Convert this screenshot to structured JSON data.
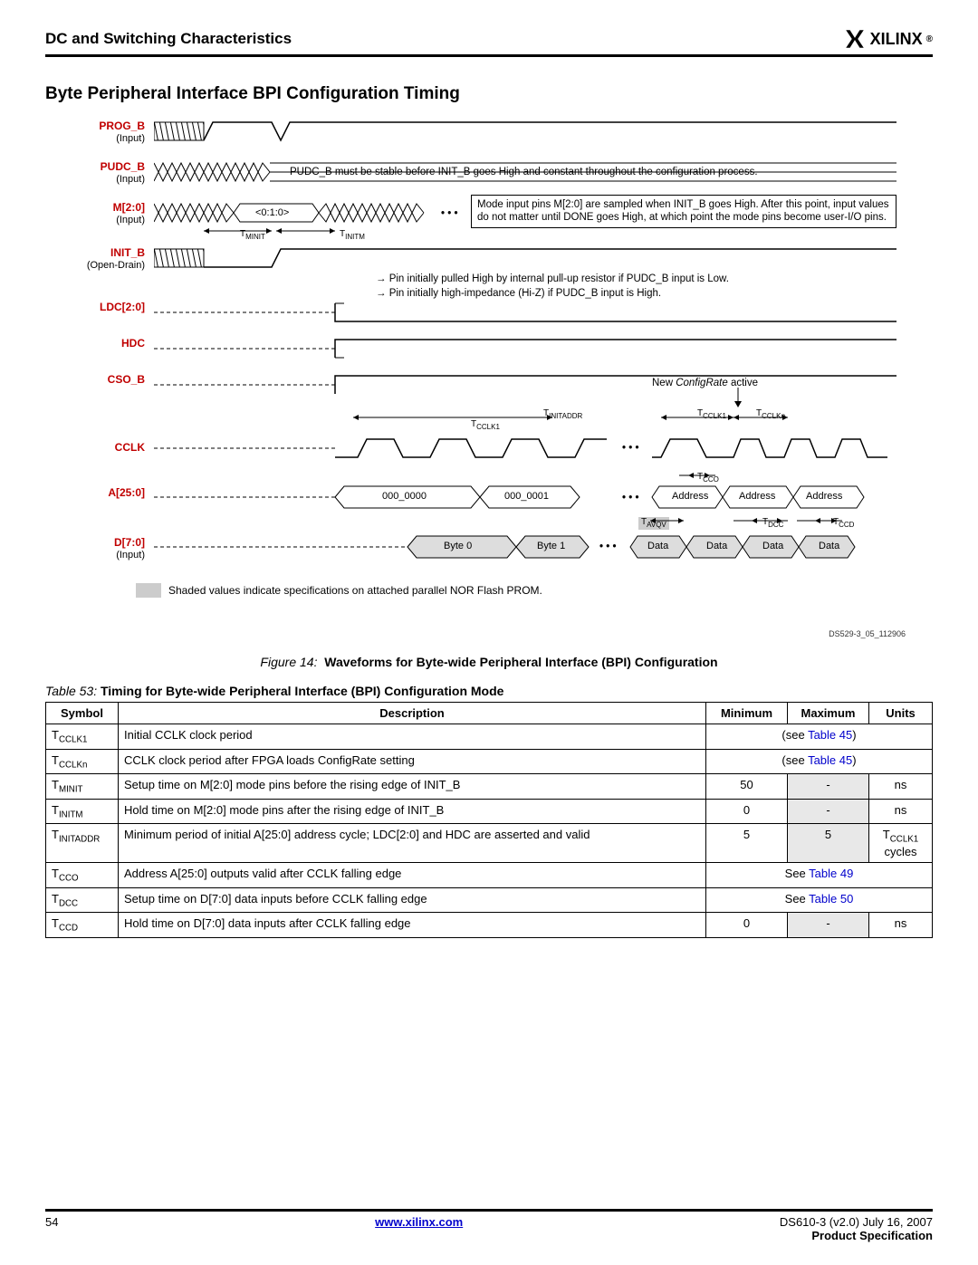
{
  "header": {
    "title": "DC and Switching Characteristics",
    "brand": "XILINX"
  },
  "section_title": "Byte Peripheral Interface BPI Configuration Timing",
  "diagram": {
    "signals": {
      "prog_b": {
        "name": "PROG_B",
        "sub": "(Input)"
      },
      "pudc_b": {
        "name": "PUDC_B",
        "sub": "(Input)"
      },
      "m20": {
        "name": "M[2:0]",
        "sub": "(Input)"
      },
      "init_b": {
        "name": "INIT_B",
        "sub": "(Open-Drain)"
      },
      "ldc": {
        "name": "LDC[2:0]"
      },
      "hdc": {
        "name": "HDC"
      },
      "cso_b": {
        "name": "CSO_B"
      },
      "cclk": {
        "name": "CCLK"
      },
      "a25": {
        "name": "A[25:0]"
      },
      "d7": {
        "name": "D[7:0]",
        "sub": "(Input)"
      }
    },
    "m_value": "<0:1:0>",
    "tlabels": {
      "tminit": "MINIT",
      "tinitm": "INITM",
      "tinitaddr": "INITADDR",
      "tcclk1": "CCLK1",
      "tcclkn": "CCLKn",
      "tcco": "CCO",
      "tavqv": "AVQV",
      "tdcc": "DCC",
      "tccd": "CCD"
    },
    "notes": {
      "pudc": "PUDC_B must be stable before INIT_B goes High and constant throughout the configuration process.",
      "mode": "Mode input pins M[2:0] are sampled when INIT_B goes High. After this point, input values do not matter until DONE goes High, at which point the mode pins become user-I/O pins.",
      "init_low": "Pin initially pulled High by internal pull-up resistor if PUDC_B input is Low.",
      "init_hiz": "Pin initially high-impedance (Hi-Z) if PUDC_B input is High.",
      "configrate": "New ConfigRate active"
    },
    "addr_values": {
      "a0": "000_0000",
      "a1": "000_0001",
      "an": "Address"
    },
    "data_values": {
      "d0": "Byte 0",
      "d1": "Byte 1",
      "dn": "Data"
    },
    "shaded_note": "Shaded values indicate specifications on attached parallel NOR Flash PROM.",
    "ds_id": "DS529-3_05_112906"
  },
  "figure_caption": {
    "prefix": "Figure 14:",
    "text": "Waveforms for Byte-wide Peripheral Interface (BPI) Configuration"
  },
  "table_caption": {
    "prefix": "Table  53:",
    "text": "Timing for Byte-wide Peripheral Interface (BPI) Configuration Mode"
  },
  "table": {
    "headers": {
      "sym": "Symbol",
      "desc": "Description",
      "min": "Minimum",
      "max": "Maximum",
      "units": "Units"
    },
    "rows": [
      {
        "sym_pre": "T",
        "sym_sub": "CCLK1",
        "desc": "Initial CCLK clock period",
        "span": "(see Table 45)",
        "link": "Table 45"
      },
      {
        "sym_pre": "T",
        "sym_sub": "CCLKn",
        "desc": "CCLK clock period after FPGA loads ConfigRate setting",
        "span": "(see Table 45)",
        "link": "Table 45"
      },
      {
        "sym_pre": "T",
        "sym_sub": "MINIT",
        "desc": "Setup time on M[2:0] mode pins before the rising edge of INIT_B",
        "min": "50",
        "max": "-",
        "units": "ns"
      },
      {
        "sym_pre": "T",
        "sym_sub": "INITM",
        "desc": "Hold time on M[2:0] mode pins after the rising edge of INIT_B",
        "min": "0",
        "max": "-",
        "units": "ns"
      },
      {
        "sym_pre": "T",
        "sym_sub": "INITADDR",
        "desc": "Minimum period of initial A[25:0] address cycle; LDC[2:0] and HDC are asserted and valid",
        "min": "5",
        "max": "5",
        "units_html": "T<sub>CCLK1</sub> cycles"
      },
      {
        "sym_pre": "T",
        "sym_sub": "CCO",
        "desc": "Address A[25:0] outputs valid after CCLK falling edge",
        "span": "See Table 49",
        "link": "Table 49"
      },
      {
        "sym_pre": "T",
        "sym_sub": "DCC",
        "desc": "Setup time on D[7:0] data inputs before CCLK falling edge",
        "span": "See Table 50",
        "link": "Table 50"
      },
      {
        "sym_pre": "T",
        "sym_sub": "CCD",
        "desc": "Hold time on D[7:0] data inputs after CCLK falling edge",
        "min": "0",
        "max": "-",
        "units": "ns"
      }
    ]
  },
  "footer": {
    "page": "54",
    "url": "www.xilinx.com",
    "doc": "DS610-3 (v2.0) July 16, 2007",
    "spec": "Product Specification"
  }
}
